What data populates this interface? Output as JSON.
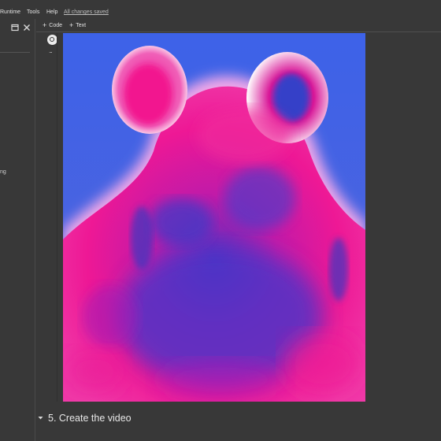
{
  "menu": {
    "items": [
      "Runtime",
      "Tools",
      "Help"
    ],
    "save_status": "All changes saved"
  },
  "toolbar": {
    "code_label": "Code",
    "text_label": "Text"
  },
  "left_panel": {
    "fragment_text": "ng"
  },
  "cell": {
    "more_label": "..."
  },
  "output": {
    "image_description": "generated artwork: neon pink and blue glowing hippo"
  },
  "section": {
    "title": "5. Create the video"
  },
  "colors": {
    "background": "#383838",
    "image_blue": "#3f63e6",
    "image_pink": "#e8149a",
    "image_glow": "#ffffff"
  },
  "icons": [
    "window-icon",
    "close-icon",
    "plus-icon",
    "run-cell-icon",
    "chevron-down-icon"
  ]
}
